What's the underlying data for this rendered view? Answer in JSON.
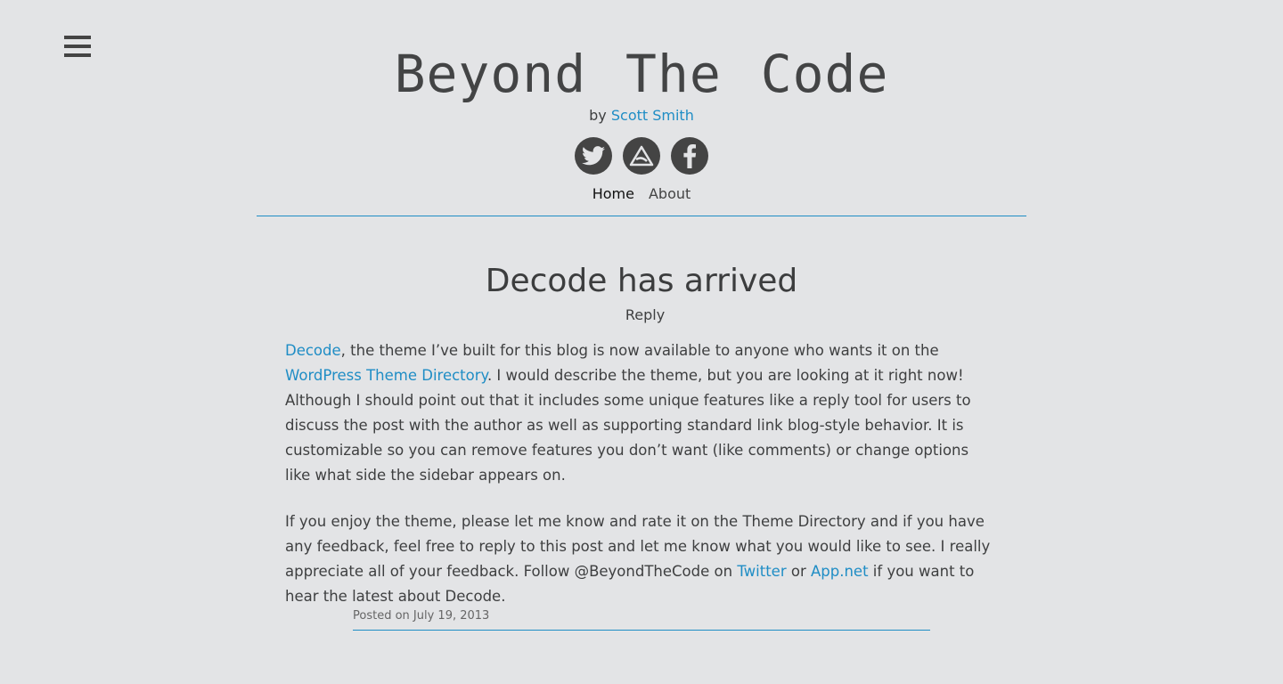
{
  "site": {
    "title": "Beyond The Code",
    "byline_prefix": "by",
    "author": "Scott Smith"
  },
  "social": [
    {
      "name": "twitter-icon"
    },
    {
      "name": "appnet-icon"
    },
    {
      "name": "facebook-icon"
    }
  ],
  "nav": {
    "home": "Home",
    "about": "About"
  },
  "post": {
    "title": "Decode has arrived",
    "reply": "Reply",
    "p1": {
      "link1": "Decode",
      "text1": ", the theme I’ve built for this blog is now available to anyone who wants it on the ",
      "link2": "WordPress Theme Directory",
      "text2": ". I would describe the theme, but you are looking at it right now! Although I should point out that it includes some unique features like a reply tool for users to discuss the post with the author as well as supporting standard link blog-style behavior. It is customizable so you can remove features you don’t want (like comments) or change options like what side the sidebar appears on."
    },
    "p2": {
      "text1": "If you enjoy the theme, please let me know and rate it on the Theme Directory and if you have any feedback, feel free to reply to this post and let me know what you would like to see. I really appreciate all of your feedback. Follow @BeyondTheCode on ",
      "link1": "Twitter",
      "text2": " or ",
      "link2": "App.net",
      "text3": " if you want to hear the latest about Decode."
    },
    "meta_prefix": "Posted on",
    "date": "July 19, 2013"
  },
  "colors": {
    "background": "#e3e4e6",
    "link": "#1f8dc5",
    "text": "#3e3f40"
  }
}
